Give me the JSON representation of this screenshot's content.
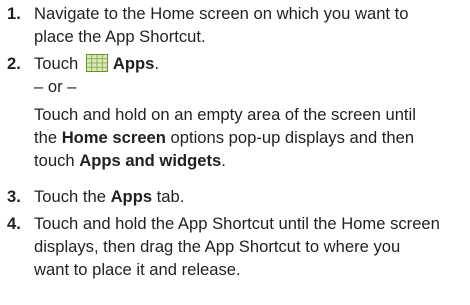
{
  "steps": [
    {
      "number": "1.",
      "lines": [
        "Navigate to the Home screen on which you want to",
        "place the App Shortcut."
      ]
    },
    {
      "number": "2.",
      "touch_prefix": "Touch",
      "icon": "apps-grid-icon",
      "icon_label": "Apps",
      "period": ".",
      "or_line": "– or –",
      "alt": {
        "line1": "Touch and hold on an empty area of the screen until",
        "line2_pre": "the ",
        "line2_bold": "Home screen",
        "line2_post": " options pop-up displays and then",
        "line3_pre": "touch ",
        "line3_bold": "Apps and widgets",
        "line3_post": "."
      }
    },
    {
      "number": "3.",
      "pre": "Touch the ",
      "bold": "Apps",
      "post": " tab."
    },
    {
      "number": "4.",
      "lines": [
        "Touch and hold the App Shortcut until the Home screen",
        "displays, then drag the App Shortcut to where you",
        "want to place it and release."
      ]
    }
  ],
  "colors": {
    "text": "#231f20",
    "icon_border": "#6b8f2a",
    "icon_fill": "#dbe9bd",
    "icon_grid": "#7ea23a"
  }
}
